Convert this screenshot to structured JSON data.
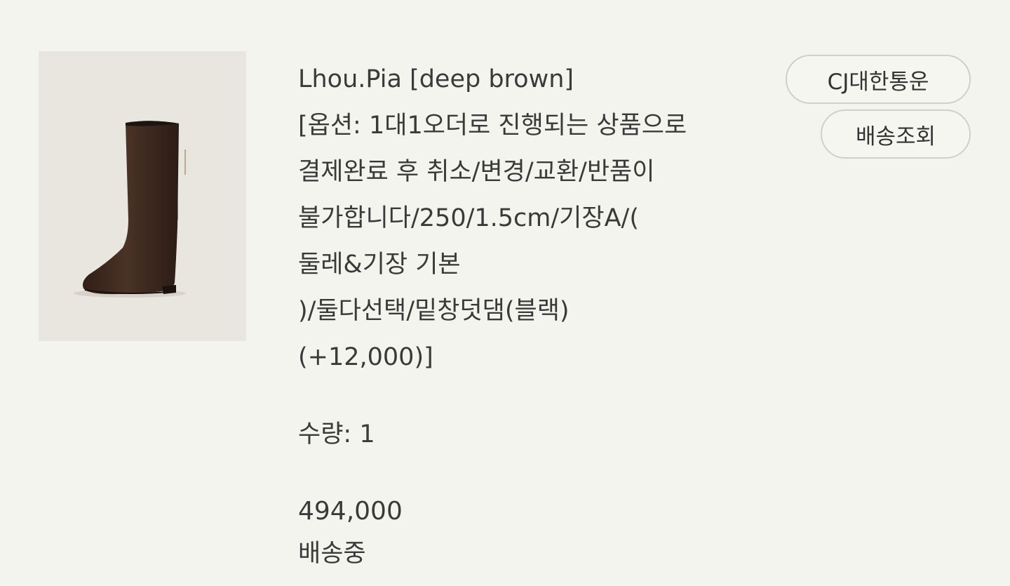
{
  "order": {
    "product_name": "Lhou.Pia [deep brown]",
    "option_lines": [
      "[옵션: 1대1오더로 진행되는 상품으로",
      "결제완료 후 취소/변경/교환/반품이",
      "불가합니다/250/1.5cm/기장A/(",
      "둘레&기장 기본",
      ")/둘다선택/밑창덧댐(블랙)",
      "(+12,000)]"
    ],
    "quantity_text": "수량: 1",
    "price": "494,000",
    "status": "배송중"
  },
  "actions": {
    "carrier_label": "CJ대한통운",
    "track_label": "배송조회"
  },
  "colors": {
    "background": "#f4f4ef",
    "text": "#3a3a3a",
    "button_border": "#cfcfcf",
    "boot": "#3f2a20"
  },
  "icons": {
    "thumbnail": "brown-knee-high-boot-image"
  }
}
